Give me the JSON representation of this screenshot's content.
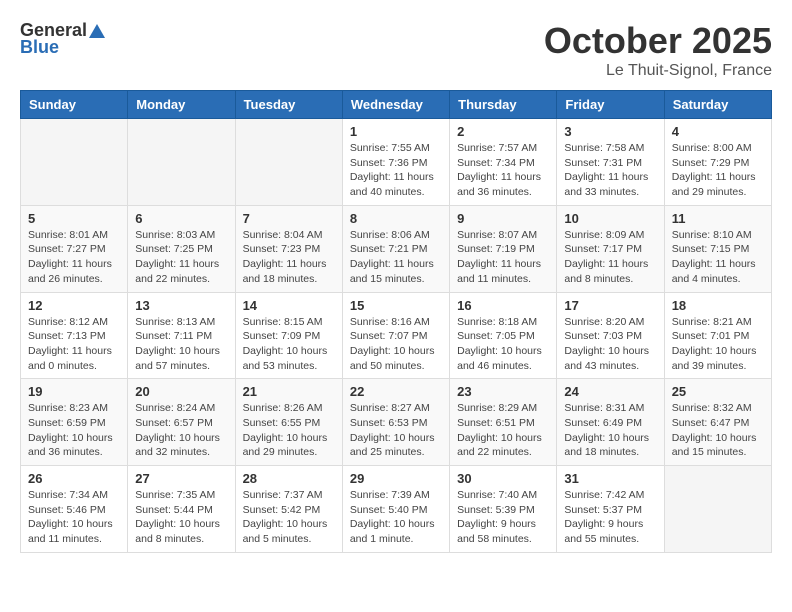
{
  "header": {
    "logo_general": "General",
    "logo_blue": "Blue",
    "month_title": "October 2025",
    "location": "Le Thuit-Signol, France"
  },
  "weekdays": [
    "Sunday",
    "Monday",
    "Tuesday",
    "Wednesday",
    "Thursday",
    "Friday",
    "Saturday"
  ],
  "weeks": [
    [
      {
        "day": "",
        "info": ""
      },
      {
        "day": "",
        "info": ""
      },
      {
        "day": "",
        "info": ""
      },
      {
        "day": "1",
        "info": "Sunrise: 7:55 AM\nSunset: 7:36 PM\nDaylight: 11 hours\nand 40 minutes."
      },
      {
        "day": "2",
        "info": "Sunrise: 7:57 AM\nSunset: 7:34 PM\nDaylight: 11 hours\nand 36 minutes."
      },
      {
        "day": "3",
        "info": "Sunrise: 7:58 AM\nSunset: 7:31 PM\nDaylight: 11 hours\nand 33 minutes."
      },
      {
        "day": "4",
        "info": "Sunrise: 8:00 AM\nSunset: 7:29 PM\nDaylight: 11 hours\nand 29 minutes."
      }
    ],
    [
      {
        "day": "5",
        "info": "Sunrise: 8:01 AM\nSunset: 7:27 PM\nDaylight: 11 hours\nand 26 minutes."
      },
      {
        "day": "6",
        "info": "Sunrise: 8:03 AM\nSunset: 7:25 PM\nDaylight: 11 hours\nand 22 minutes."
      },
      {
        "day": "7",
        "info": "Sunrise: 8:04 AM\nSunset: 7:23 PM\nDaylight: 11 hours\nand 18 minutes."
      },
      {
        "day": "8",
        "info": "Sunrise: 8:06 AM\nSunset: 7:21 PM\nDaylight: 11 hours\nand 15 minutes."
      },
      {
        "day": "9",
        "info": "Sunrise: 8:07 AM\nSunset: 7:19 PM\nDaylight: 11 hours\nand 11 minutes."
      },
      {
        "day": "10",
        "info": "Sunrise: 8:09 AM\nSunset: 7:17 PM\nDaylight: 11 hours\nand 8 minutes."
      },
      {
        "day": "11",
        "info": "Sunrise: 8:10 AM\nSunset: 7:15 PM\nDaylight: 11 hours\nand 4 minutes."
      }
    ],
    [
      {
        "day": "12",
        "info": "Sunrise: 8:12 AM\nSunset: 7:13 PM\nDaylight: 11 hours\nand 0 minutes."
      },
      {
        "day": "13",
        "info": "Sunrise: 8:13 AM\nSunset: 7:11 PM\nDaylight: 10 hours\nand 57 minutes."
      },
      {
        "day": "14",
        "info": "Sunrise: 8:15 AM\nSunset: 7:09 PM\nDaylight: 10 hours\nand 53 minutes."
      },
      {
        "day": "15",
        "info": "Sunrise: 8:16 AM\nSunset: 7:07 PM\nDaylight: 10 hours\nand 50 minutes."
      },
      {
        "day": "16",
        "info": "Sunrise: 8:18 AM\nSunset: 7:05 PM\nDaylight: 10 hours\nand 46 minutes."
      },
      {
        "day": "17",
        "info": "Sunrise: 8:20 AM\nSunset: 7:03 PM\nDaylight: 10 hours\nand 43 minutes."
      },
      {
        "day": "18",
        "info": "Sunrise: 8:21 AM\nSunset: 7:01 PM\nDaylight: 10 hours\nand 39 minutes."
      }
    ],
    [
      {
        "day": "19",
        "info": "Sunrise: 8:23 AM\nSunset: 6:59 PM\nDaylight: 10 hours\nand 36 minutes."
      },
      {
        "day": "20",
        "info": "Sunrise: 8:24 AM\nSunset: 6:57 PM\nDaylight: 10 hours\nand 32 minutes."
      },
      {
        "day": "21",
        "info": "Sunrise: 8:26 AM\nSunset: 6:55 PM\nDaylight: 10 hours\nand 29 minutes."
      },
      {
        "day": "22",
        "info": "Sunrise: 8:27 AM\nSunset: 6:53 PM\nDaylight: 10 hours\nand 25 minutes."
      },
      {
        "day": "23",
        "info": "Sunrise: 8:29 AM\nSunset: 6:51 PM\nDaylight: 10 hours\nand 22 minutes."
      },
      {
        "day": "24",
        "info": "Sunrise: 8:31 AM\nSunset: 6:49 PM\nDaylight: 10 hours\nand 18 minutes."
      },
      {
        "day": "25",
        "info": "Sunrise: 8:32 AM\nSunset: 6:47 PM\nDaylight: 10 hours\nand 15 minutes."
      }
    ],
    [
      {
        "day": "26",
        "info": "Sunrise: 7:34 AM\nSunset: 5:46 PM\nDaylight: 10 hours\nand 11 minutes."
      },
      {
        "day": "27",
        "info": "Sunrise: 7:35 AM\nSunset: 5:44 PM\nDaylight: 10 hours\nand 8 minutes."
      },
      {
        "day": "28",
        "info": "Sunrise: 7:37 AM\nSunset: 5:42 PM\nDaylight: 10 hours\nand 5 minutes."
      },
      {
        "day": "29",
        "info": "Sunrise: 7:39 AM\nSunset: 5:40 PM\nDaylight: 10 hours\nand 1 minute."
      },
      {
        "day": "30",
        "info": "Sunrise: 7:40 AM\nSunset: 5:39 PM\nDaylight: 9 hours\nand 58 minutes."
      },
      {
        "day": "31",
        "info": "Sunrise: 7:42 AM\nSunset: 5:37 PM\nDaylight: 9 hours\nand 55 minutes."
      },
      {
        "day": "",
        "info": ""
      }
    ]
  ]
}
